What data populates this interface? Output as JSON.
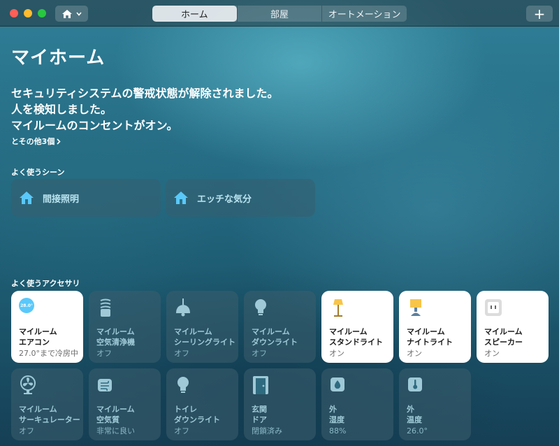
{
  "toolbar": {
    "tabs": [
      {
        "label": "ホーム",
        "active": true
      },
      {
        "label": "部屋",
        "active": false
      },
      {
        "label": "オートメーション",
        "active": false
      }
    ],
    "add_label": "+"
  },
  "home": {
    "title": "マイホーム",
    "status_lines": [
      "セキュリティシステムの警戒状態が解除されました。",
      "人を検知しました。",
      "マイルームのコンセントがオン。"
    ],
    "more_link": "とその他3個"
  },
  "scenes": {
    "section_title": "よく使うシーン",
    "items": [
      {
        "label": "間接照明",
        "icon": "house-icon"
      },
      {
        "label": "エッチな気分",
        "icon": "house-icon"
      }
    ]
  },
  "accessories": {
    "section_title": "よく使うアクセサリ",
    "items": [
      {
        "room": "マイルーム",
        "name": "エアコン",
        "status": "27.0°まで冷房中",
        "on": true,
        "icon": "thermostat-icon",
        "badge": "28.0°"
      },
      {
        "room": "マイルーム",
        "name": "空気清浄機",
        "status": "オフ",
        "on": false,
        "icon": "air-purifier-icon"
      },
      {
        "room": "マイルーム",
        "name": "シーリングライト",
        "status": "オフ",
        "on": false,
        "icon": "ceiling-light-icon"
      },
      {
        "room": "マイルーム",
        "name": "ダウンライト",
        "status": "オフ",
        "on": false,
        "icon": "lightbulb-icon"
      },
      {
        "room": "マイルーム",
        "name": "スタンドライト",
        "status": "オン",
        "on": true,
        "icon": "floor-lamp-icon"
      },
      {
        "room": "マイルーム",
        "name": "ナイトライト",
        "status": "オン",
        "on": true,
        "icon": "table-lamp-icon"
      },
      {
        "room": "マイルーム",
        "name": "スピーカー",
        "status": "オン",
        "on": true,
        "icon": "outlet-icon"
      },
      {
        "room": "マイルーム",
        "name": "サーキュレーター",
        "status": "オフ",
        "on": false,
        "icon": "fan-icon"
      },
      {
        "room": "マイルーム",
        "name": "空気質",
        "status": "非常に良い",
        "on": false,
        "icon": "air-quality-icon"
      },
      {
        "room": "トイレ",
        "name": "ダウンライト",
        "status": "オフ",
        "on": false,
        "icon": "lightbulb-icon"
      },
      {
        "room": "玄関",
        "name": "ドア",
        "status": "閉鎖済み",
        "on": false,
        "icon": "door-icon"
      },
      {
        "room": "外",
        "name": "湿度",
        "status": "88%",
        "on": false,
        "icon": "humidity-icon"
      },
      {
        "room": "外",
        "name": "温度",
        "status": "26.0°",
        "on": false,
        "icon": "temperature-icon"
      }
    ]
  },
  "colors": {
    "accent": "#5ac8fa",
    "lamp_yellow": "#f7c548",
    "tile_off": "#3c5f6e",
    "tile_on": "#ffffff"
  }
}
